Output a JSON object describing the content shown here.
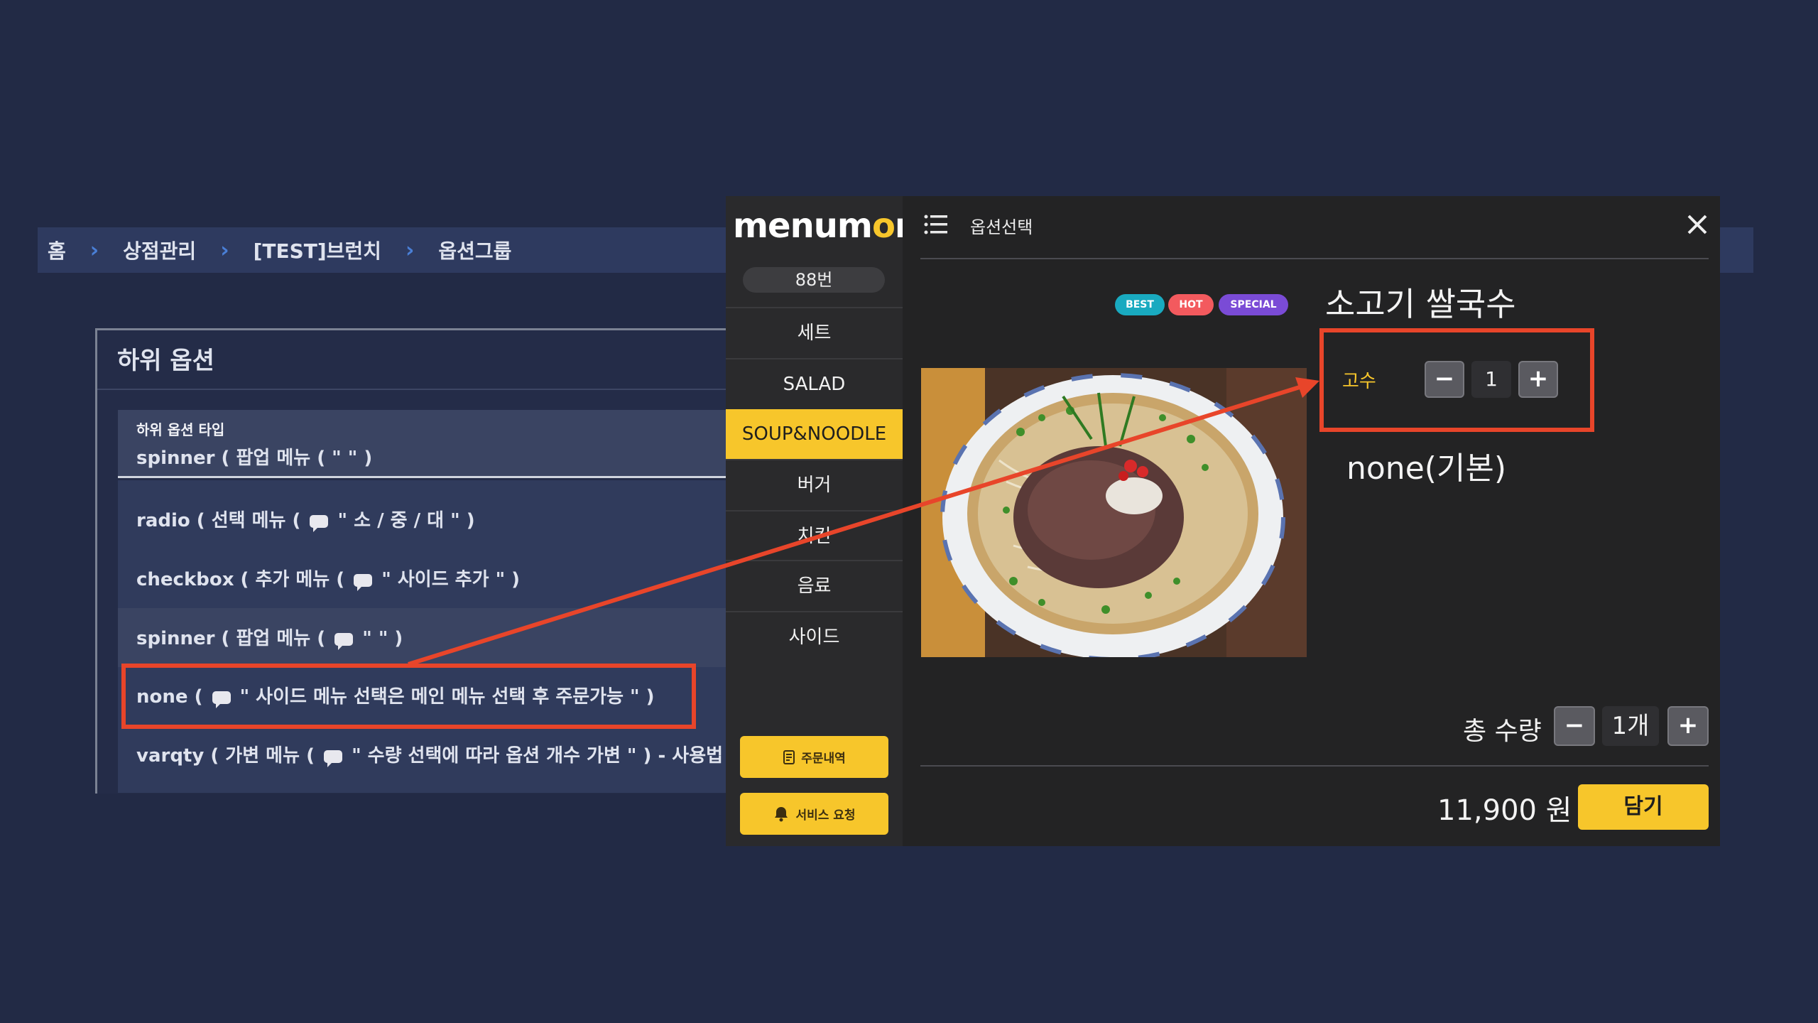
{
  "breadcrumb": {
    "items": [
      "홈",
      "상점관리",
      "[TEST]브런치",
      "옵션그룹"
    ],
    "separator": "›"
  },
  "subpanel": {
    "title": "하위 옵션",
    "type_label": "하위 옵션 타입",
    "type_value": "spinner ( 팝업 메뉴 ( \" \" )",
    "options": [
      {
        "pre": "radio ( 선택 메뉴 ( ",
        "post": " \" 소 / 중 / 대 \" )"
      },
      {
        "pre": "checkbox ( 추가 메뉴 ( ",
        "post": " \" 사이드 추가 \" )"
      },
      {
        "pre": "spinner ( 팝업 메뉴 ( ",
        "post": " \" \" )"
      },
      {
        "pre": "none ( ",
        "post": " \" 사이드 메뉴 선택은 메인 메뉴 선택 후 주문가능 \" )"
      },
      {
        "pre": "varqty ( 가변 메뉴 ( ",
        "post": " \" 수량 선택에 따라 옵션 개수 가변 \" ) - 사용법"
      }
    ]
  },
  "app": {
    "logo_a": "menum",
    "logo_o": "o",
    "logo_b": "n",
    "table_number": "88번",
    "categories": [
      "세트",
      "SALAD",
      "SOUP&NOODLE",
      "버거",
      "치킨",
      "음료",
      "사이드"
    ],
    "active_category": "SOUP&NOODLE",
    "order_history_label": "주문내역",
    "service_request_label": "서비스 요청",
    "modal_title": "옵션선택",
    "badges": [
      "BEST",
      "HOT",
      "SPECIAL"
    ],
    "dish_name": "소고기 쌀국수",
    "option_name": "고수",
    "option_quantity": "1",
    "annotation": "none(기본)",
    "total_label": "총 수량",
    "total_quantity": "1개",
    "price": "11,900 원",
    "add_button": "담기",
    "minus": "−",
    "plus": "+"
  },
  "colors": {
    "background": "#222a45",
    "accent_yellow": "#f7c62b",
    "highlight_red": "#e8452a",
    "badge_best": "#19aac0",
    "badge_hot": "#f35a5e",
    "badge_special": "#7a4bd6"
  }
}
